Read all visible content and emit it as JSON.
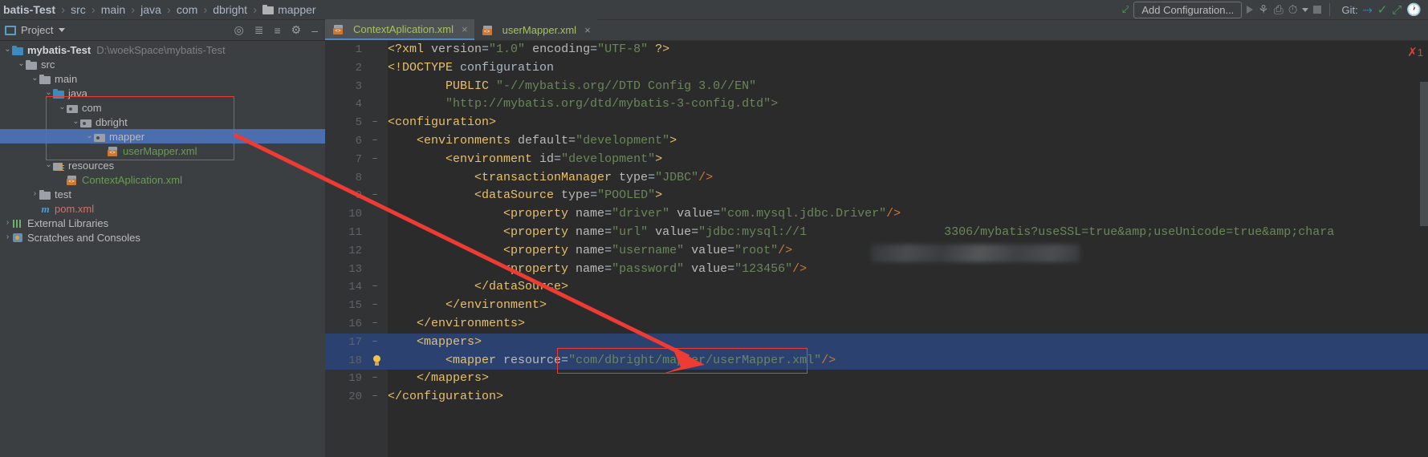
{
  "breadcrumb": {
    "items": [
      "batis-Test",
      "src",
      "main",
      "java",
      "com",
      "dbright",
      "mapper"
    ],
    "separator": "›"
  },
  "toolbar": {
    "add_configuration": "Add Configuration...",
    "git_label": "Git:",
    "icons": [
      "build-icon",
      "run-icon",
      "debug-icon",
      "run-coverage-icon",
      "profile-icon",
      "dropdown-icon",
      "stop-icon",
      "update-project-icon",
      "commit-icon",
      "push-icon",
      "history-icon"
    ]
  },
  "project_panel": {
    "title": "Project",
    "actions": [
      "locate-icon",
      "expand-all-icon",
      "collapse-all-icon",
      "settings-icon",
      "hide-icon"
    ],
    "tree": [
      {
        "label": "mybatis-Test",
        "path": "D:\\woekSpace\\mybatis-Test",
        "indent": 0,
        "arrow": "⌄",
        "icon": "project-folder",
        "style": "bold",
        "selected": false
      },
      {
        "label": "src",
        "path": "",
        "indent": 1,
        "arrow": "⌄",
        "icon": "folder",
        "style": "",
        "selected": false
      },
      {
        "label": "main",
        "path": "",
        "indent": 2,
        "arrow": "⌄",
        "icon": "folder",
        "style": "",
        "selected": false
      },
      {
        "label": "java",
        "path": "",
        "indent": 3,
        "arrow": "⌄",
        "icon": "folder-src",
        "style": "",
        "selected": false
      },
      {
        "label": "com",
        "path": "",
        "indent": 4,
        "arrow": "⌄",
        "icon": "pkg",
        "style": "",
        "selected": false
      },
      {
        "label": "dbright",
        "path": "",
        "indent": 5,
        "arrow": "⌄",
        "icon": "pkg",
        "style": "",
        "selected": false
      },
      {
        "label": "mapper",
        "path": "",
        "indent": 6,
        "arrow": "⌄",
        "icon": "pkg",
        "style": "",
        "selected": true
      },
      {
        "label": "userMapper.xml",
        "path": "",
        "indent": 7,
        "arrow": "",
        "icon": "xml",
        "style": "green",
        "selected": false
      },
      {
        "label": "resources",
        "path": "",
        "indent": 3,
        "arrow": "⌄",
        "icon": "res",
        "style": "",
        "selected": false
      },
      {
        "label": "ContextAplication.xml",
        "path": "",
        "indent": 4,
        "arrow": "",
        "icon": "xml",
        "style": "green",
        "selected": false
      },
      {
        "label": "test",
        "path": "",
        "indent": 2,
        "arrow": "›",
        "icon": "folder",
        "style": "",
        "selected": false
      },
      {
        "label": "pom.xml",
        "path": "",
        "indent": 2,
        "arrow": "",
        "icon": "maven",
        "style": "red",
        "selected": false
      },
      {
        "label": "External Libraries",
        "path": "",
        "indent": 0,
        "arrow": "›",
        "icon": "libs",
        "style": "",
        "selected": false
      },
      {
        "label": "Scratches and Consoles",
        "path": "",
        "indent": 0,
        "arrow": "›",
        "icon": "scratch",
        "style": "",
        "selected": false
      }
    ]
  },
  "editor": {
    "tabs": [
      {
        "label": "ContextAplication.xml",
        "active": true,
        "icon": "xml-file-icon",
        "close": "×"
      },
      {
        "label": "userMapper.xml",
        "active": false,
        "icon": "xml-file-icon",
        "close": "×"
      }
    ],
    "error_count": "1",
    "lines": [
      {
        "n": "1",
        "fold": "",
        "indent": 0,
        "hl": false,
        "bulb": false,
        "tokens": [
          {
            "t": "<?xml ",
            "c": "t-tag"
          },
          {
            "t": "version",
            "c": "t-attr2"
          },
          {
            "t": "=",
            "c": "t-plain"
          },
          {
            "t": "\"1.0\"",
            "c": "t-val"
          },
          {
            "t": " encoding",
            "c": "t-attr2"
          },
          {
            "t": "=",
            "c": "t-plain"
          },
          {
            "t": "\"UTF-8\"",
            "c": "t-val"
          },
          {
            "t": " ?>",
            "c": "t-tag"
          }
        ]
      },
      {
        "n": "2",
        "fold": "",
        "indent": 0,
        "hl": false,
        "bulb": false,
        "tokens": [
          {
            "t": "<!DOCTYPE",
            "c": "t-doc"
          },
          {
            "t": " configuration",
            "c": "t-plain"
          }
        ]
      },
      {
        "n": "3",
        "fold": "",
        "indent": 0,
        "hl": false,
        "bulb": false,
        "tokens": [
          {
            "t": "        PUBLIC ",
            "c": "t-doc"
          },
          {
            "t": "\"-//mybatis.org//DTD Config 3.0//EN\"",
            "c": "t-val"
          }
        ]
      },
      {
        "n": "4",
        "fold": "",
        "indent": 0,
        "hl": false,
        "bulb": false,
        "tokens": [
          {
            "t": "        ",
            "c": "t-plain"
          },
          {
            "t": "\"http://mybatis.org/dtd/mybatis-3-config.dtd\">",
            "c": "t-val"
          }
        ]
      },
      {
        "n": "5",
        "fold": "−",
        "indent": 0,
        "hl": false,
        "bulb": false,
        "tokens": [
          {
            "t": "<configuration>",
            "c": "t-tag"
          }
        ]
      },
      {
        "n": "6",
        "fold": "−",
        "indent": 1,
        "hl": false,
        "bulb": false,
        "tokens": [
          {
            "t": "    <environments ",
            "c": "t-tag"
          },
          {
            "t": "default",
            "c": "t-attr2"
          },
          {
            "t": "=",
            "c": "t-plain"
          },
          {
            "t": "\"development\"",
            "c": "t-val"
          },
          {
            "t": ">",
            "c": "t-tag"
          }
        ]
      },
      {
        "n": "7",
        "fold": "−",
        "indent": 2,
        "hl": false,
        "bulb": false,
        "tokens": [
          {
            "t": "        <environment ",
            "c": "t-tag"
          },
          {
            "t": "id",
            "c": "t-attr2"
          },
          {
            "t": "=",
            "c": "t-plain"
          },
          {
            "t": "\"development\"",
            "c": "t-val"
          },
          {
            "t": ">",
            "c": "t-tag"
          }
        ]
      },
      {
        "n": "8",
        "fold": "",
        "indent": 3,
        "hl": false,
        "bulb": false,
        "tokens": [
          {
            "t": "            <transactionManager ",
            "c": "t-tag"
          },
          {
            "t": "type",
            "c": "t-attr2"
          },
          {
            "t": "=",
            "c": "t-plain"
          },
          {
            "t": "\"JDBC\"",
            "c": "t-val"
          },
          {
            "t": "/>",
            "c": "t-punc"
          }
        ]
      },
      {
        "n": "9",
        "fold": "−",
        "indent": 3,
        "hl": false,
        "bulb": false,
        "tokens": [
          {
            "t": "            <dataSource ",
            "c": "t-tag"
          },
          {
            "t": "type",
            "c": "t-attr2"
          },
          {
            "t": "=",
            "c": "t-plain"
          },
          {
            "t": "\"POOLED\"",
            "c": "t-val"
          },
          {
            "t": ">",
            "c": "t-tag"
          }
        ]
      },
      {
        "n": "10",
        "fold": "",
        "indent": 4,
        "hl": false,
        "bulb": false,
        "tokens": [
          {
            "t": "                <property ",
            "c": "t-tag"
          },
          {
            "t": "name",
            "c": "t-attr2"
          },
          {
            "t": "=",
            "c": "t-plain"
          },
          {
            "t": "\"driver\"",
            "c": "t-val"
          },
          {
            "t": " value",
            "c": "t-attr2"
          },
          {
            "t": "=",
            "c": "t-plain"
          },
          {
            "t": "\"com.mysql.jdbc.Driver\"",
            "c": "t-val"
          },
          {
            "t": "/>",
            "c": "t-punc"
          }
        ]
      },
      {
        "n": "11",
        "fold": "",
        "indent": 4,
        "hl": false,
        "bulb": false,
        "tokens": [
          {
            "t": "                <property ",
            "c": "t-tag"
          },
          {
            "t": "name",
            "c": "t-attr2"
          },
          {
            "t": "=",
            "c": "t-plain"
          },
          {
            "t": "\"url\"",
            "c": "t-val"
          },
          {
            "t": " value",
            "c": "t-attr2"
          },
          {
            "t": "=",
            "c": "t-plain"
          },
          {
            "t": "\"jdbc:mysql://1                   3306/mybatis?useSSL=true",
            "c": "t-val"
          },
          {
            "t": "&amp;",
            "c": "t-ent"
          },
          {
            "t": "useUnicode=true",
            "c": "t-val"
          },
          {
            "t": "&amp;",
            "c": "t-ent"
          },
          {
            "t": "chara",
            "c": "t-val"
          }
        ]
      },
      {
        "n": "12",
        "fold": "",
        "indent": 4,
        "hl": false,
        "bulb": false,
        "tokens": [
          {
            "t": "                <property ",
            "c": "t-tag"
          },
          {
            "t": "name",
            "c": "t-attr2"
          },
          {
            "t": "=",
            "c": "t-plain"
          },
          {
            "t": "\"username\"",
            "c": "t-val"
          },
          {
            "t": " value",
            "c": "t-attr2"
          },
          {
            "t": "=",
            "c": "t-plain"
          },
          {
            "t": "\"root\"",
            "c": "t-val"
          },
          {
            "t": "/>",
            "c": "t-punc"
          }
        ]
      },
      {
        "n": "13",
        "fold": "",
        "indent": 4,
        "hl": false,
        "bulb": false,
        "tokens": [
          {
            "t": "                <property ",
            "c": "t-tag"
          },
          {
            "t": "name",
            "c": "t-attr2"
          },
          {
            "t": "=",
            "c": "t-plain"
          },
          {
            "t": "\"password\"",
            "c": "t-val"
          },
          {
            "t": " value",
            "c": "t-attr2"
          },
          {
            "t": "=",
            "c": "t-plain"
          },
          {
            "t": "\"123456\"",
            "c": "t-val"
          },
          {
            "t": "/>",
            "c": "t-punc"
          }
        ]
      },
      {
        "n": "14",
        "fold": "−",
        "indent": 3,
        "hl": false,
        "bulb": false,
        "tokens": [
          {
            "t": "            </dataSource>",
            "c": "t-tag"
          }
        ]
      },
      {
        "n": "15",
        "fold": "−",
        "indent": 2,
        "hl": false,
        "bulb": false,
        "tokens": [
          {
            "t": "        </environment>",
            "c": "t-tag"
          }
        ]
      },
      {
        "n": "16",
        "fold": "−",
        "indent": 1,
        "hl": false,
        "bulb": false,
        "tokens": [
          {
            "t": "    </environments>",
            "c": "t-tag"
          }
        ]
      },
      {
        "n": "17",
        "fold": "−",
        "indent": 1,
        "hl": true,
        "bulb": false,
        "tokens": [
          {
            "t": "    <mappers>",
            "c": "t-tag"
          }
        ]
      },
      {
        "n": "18",
        "fold": "",
        "indent": 2,
        "hl": true,
        "bulb": true,
        "tokens": [
          {
            "t": "        <mapper ",
            "c": "t-tag"
          },
          {
            "t": "resource",
            "c": "t-attr2"
          },
          {
            "t": "=",
            "c": "t-plain"
          },
          {
            "t": "\"com/dbright/mapper/userMapper.xml\"",
            "c": "t-val"
          },
          {
            "t": "/>",
            "c": "t-punc"
          }
        ]
      },
      {
        "n": "19",
        "fold": "−",
        "indent": 1,
        "hl": false,
        "bulb": false,
        "tokens": [
          {
            "t": "    </mappers>",
            "c": "t-tag"
          }
        ]
      },
      {
        "n": "20",
        "fold": "−",
        "indent": 0,
        "hl": false,
        "bulb": false,
        "tokens": [
          {
            "t": "</configuration>",
            "c": "t-tag"
          }
        ]
      }
    ]
  },
  "annotations": {
    "tree_highlight_box": "red-rectangle-around-package-path",
    "code_highlight_box": "red-rectangle-around-mapper-resource",
    "arrow": "red-arrow-from-mapper-folder-to-mapper-resource",
    "color": "#ee3b34"
  }
}
